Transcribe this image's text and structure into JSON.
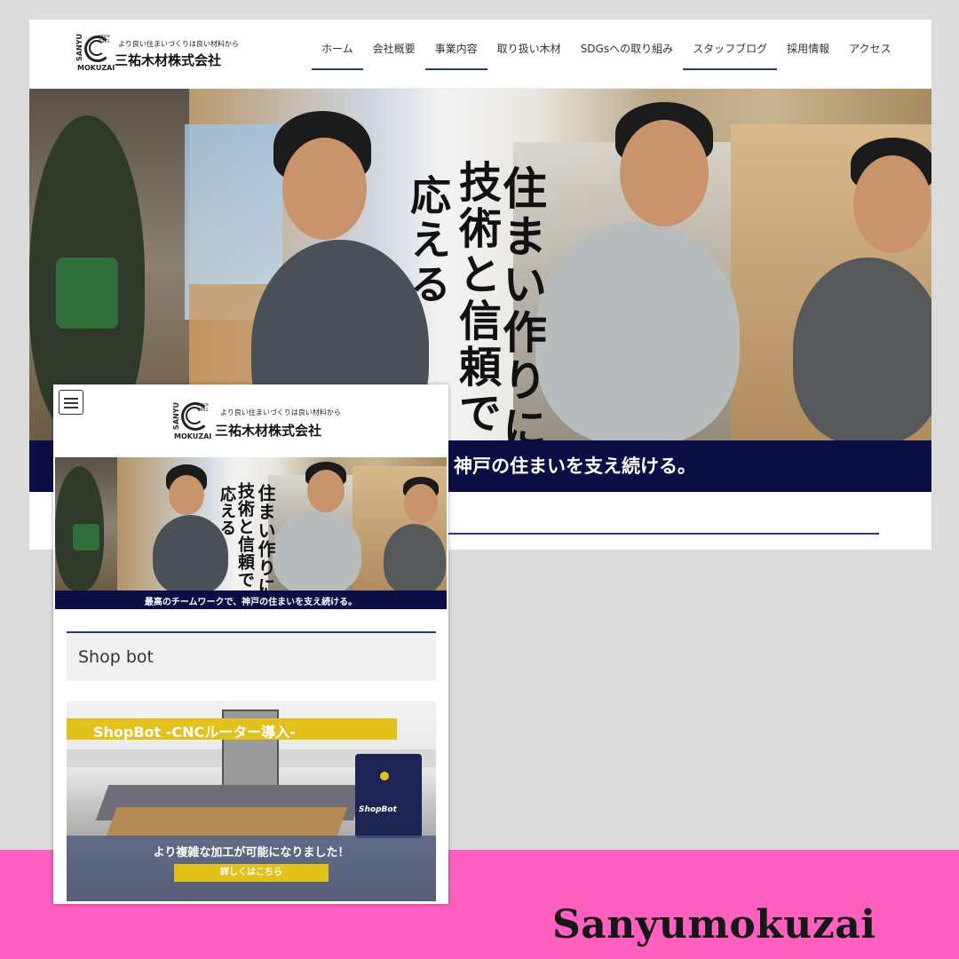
{
  "desktop": {
    "logo": {
      "tagline": "より良い住まいづくりは良い材料から",
      "company_name": "三祐木材株式会社",
      "mark_sanyu": "SANYU",
      "mark_mokuzai": "MOKUZAI",
      "mark_since": "since 1961"
    },
    "nav": [
      {
        "label": "ホーム",
        "active": true
      },
      {
        "label": "会社概要",
        "active": false
      },
      {
        "label": "事業内容",
        "active": true
      },
      {
        "label": "取り扱い木材",
        "active": false
      },
      {
        "label": "SDGsへの取り組み",
        "active": false
      },
      {
        "label": "スタッフブログ",
        "active": true
      },
      {
        "label": "採用情報",
        "active": false
      },
      {
        "label": "アクセス",
        "active": false
      }
    ],
    "hero": {
      "copy_line1": "住まい作りに",
      "copy_line2": "技術と信頼で",
      "copy_line3": "応える",
      "band_text": "神戸の住まいを支え続ける。"
    }
  },
  "mobile": {
    "logo": {
      "tagline": "より良い住まいづくりは良い材料から",
      "company_name": "三祐木材株式会社",
      "mark_sanyu": "SANYU",
      "mark_mokuzai": "MOKUZAI",
      "mark_since": "since 1961"
    },
    "hero": {
      "copy_line1": "住まい作りに",
      "copy_line2": "技術と信頼で",
      "copy_line3": "応える",
      "band_text": "最高のチームワークで、神戸の住まいを支え続ける。"
    },
    "section_heading": "Shop bot",
    "card": {
      "title": "ShopBot -CNCルーター導入-",
      "machine_brand": "ShopBot",
      "message": "より複雑な加工が可能になりました！",
      "cta": "詳しくはこちら"
    }
  },
  "caption": "Sanyumokuzai"
}
